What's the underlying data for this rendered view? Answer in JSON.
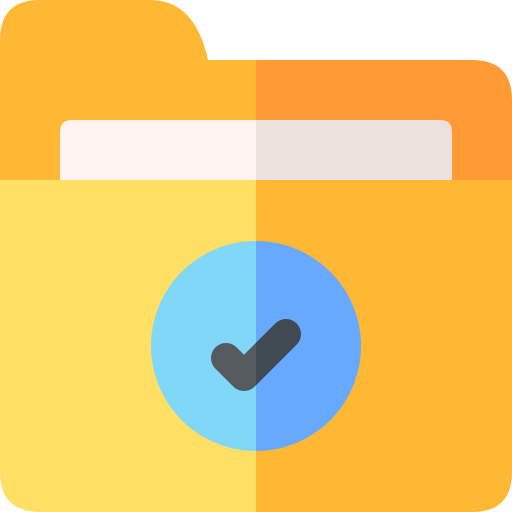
{
  "icon": {
    "name": "folder-check-icon",
    "colors": {
      "tab_left": "#FFB833",
      "tab_right": "#FF9A35",
      "paper_left": "#FFF4F2",
      "paper_right": "#EDE1DE",
      "body_left": "#FFE065",
      "body_right": "#FFB833",
      "circle_left": "#80D7F7",
      "circle_right": "#67A9FF",
      "check_left": "#555A5F",
      "check_right": "#404A52"
    }
  }
}
